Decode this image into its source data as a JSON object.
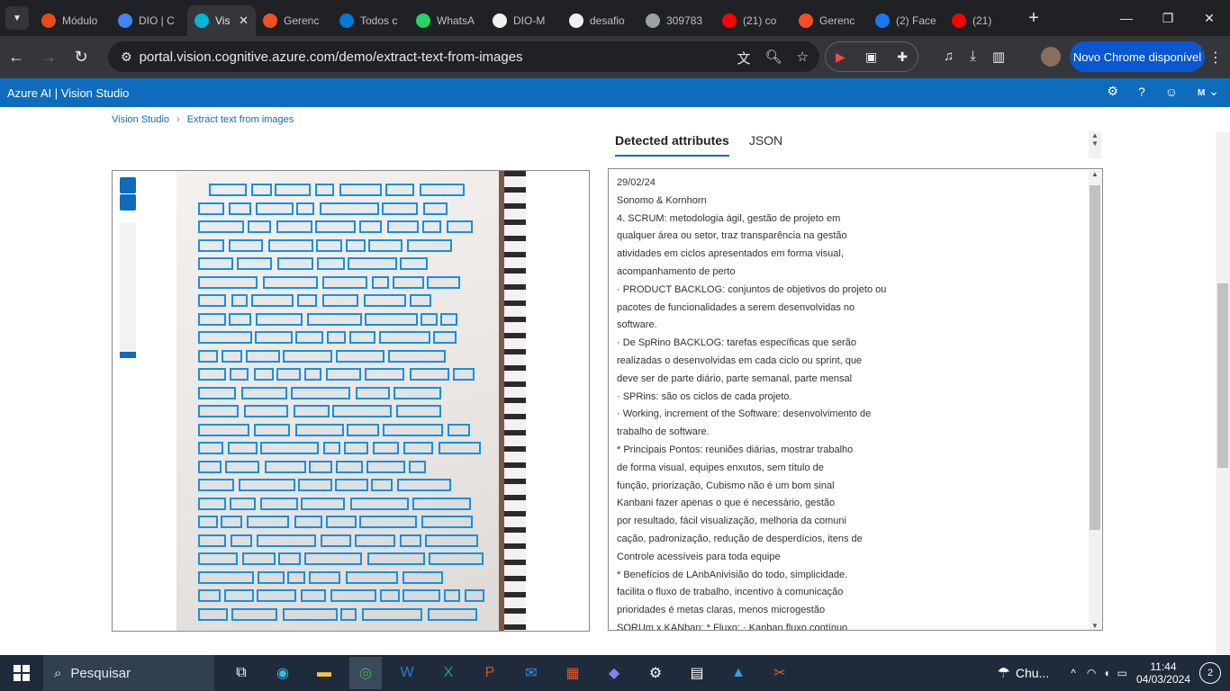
{
  "browser": {
    "tabs": [
      {
        "title": "Módulo",
        "color": "#e64a19"
      },
      {
        "title": "DIO | C",
        "color": "#4285f4"
      },
      {
        "title": "Vis",
        "color": "#00b4d8",
        "active": true
      },
      {
        "title": "Gerenc",
        "color": "#f25022"
      },
      {
        "title": "Todos c",
        "color": "#0078d4"
      },
      {
        "title": "WhatsA",
        "color": "#25d366"
      },
      {
        "title": "DIO-M",
        "color": "#f0f0f0"
      },
      {
        "title": "desafio",
        "color": "#f0f0f0"
      },
      {
        "title": "309783",
        "color": "#9aa0a6"
      },
      {
        "title": "(21) co",
        "color": "#ff0000"
      },
      {
        "title": "Gerenc",
        "color": "#f25022"
      },
      {
        "title": "(2) Face",
        "color": "#1877f2"
      },
      {
        "title": "(21)",
        "color": "#ff0000"
      }
    ],
    "url": "portal.vision.cognitive.azure.com/demo/extract-text-from-images",
    "update_label": "Novo Chrome disponível"
  },
  "azure": {
    "brand": "Azure AI  |  Vision Studio",
    "avatar_initial": "M"
  },
  "breadcrumb": {
    "home": "Vision Studio",
    "current": "Extract text from images"
  },
  "result_tabs": {
    "attributes": "Detected attributes",
    "json": "JSON"
  },
  "detected_lines": [
    "29/02/24",
    "Sonomo & Kornhorn",
    "4. SCRUM: metodologia ágil, gestão de projeto em",
    "qualquer área ou setor, traz transparência na gestão",
    "atividades em ciclos apresentados em forma visual,",
    "acompanhamento de perto",
    "· PRODUCT BACKLOG: conjuntos de objetivos do projeto ou",
    "pacotes de funcionalidades a serem desenvolvidas no",
    "software.",
    "· De SpRino BACKLOG: tarefas específicas que serão",
    "realizadas o desenvolvidas em cada ciclo ou sprint, que",
    "deve ser de parte diário, parte semanal, parte mensal",
    "· SPRins: são os ciclos de cada projeto.",
    "· Working, increment of the Software: desenvolvimento de",
    "trabalho de software.",
    "* Principais Pontos: reuniões diárias, mostrar trabalho",
    "de forma visual, equipes enxutos, sem título de",
    "função, priorização, Cubismo não é um bom sinal",
    "Kanbani fazer apenas o que é necessário, gestão",
    "por resultado, fácil visualização, melhoria da comuni",
    "cação, padronização, redução de desperdícios, itens de",
    "Controle acessíveis para toda equipe",
    "* Benefícios de LAnbAnivisião do todo, simplicidade.",
    "facilita o fluxo de trabalho, incentivo à comunicação",
    "prioridades é metas claras, menos microgestão",
    "SORUm x KANban: * Fluxo: · Kanban fluxo contínuo"
  ],
  "taskbar": {
    "search_label": "Pesquisar",
    "weather": "Chu...",
    "time": "11:44",
    "date": "04/03/2024",
    "notifications": "2"
  }
}
